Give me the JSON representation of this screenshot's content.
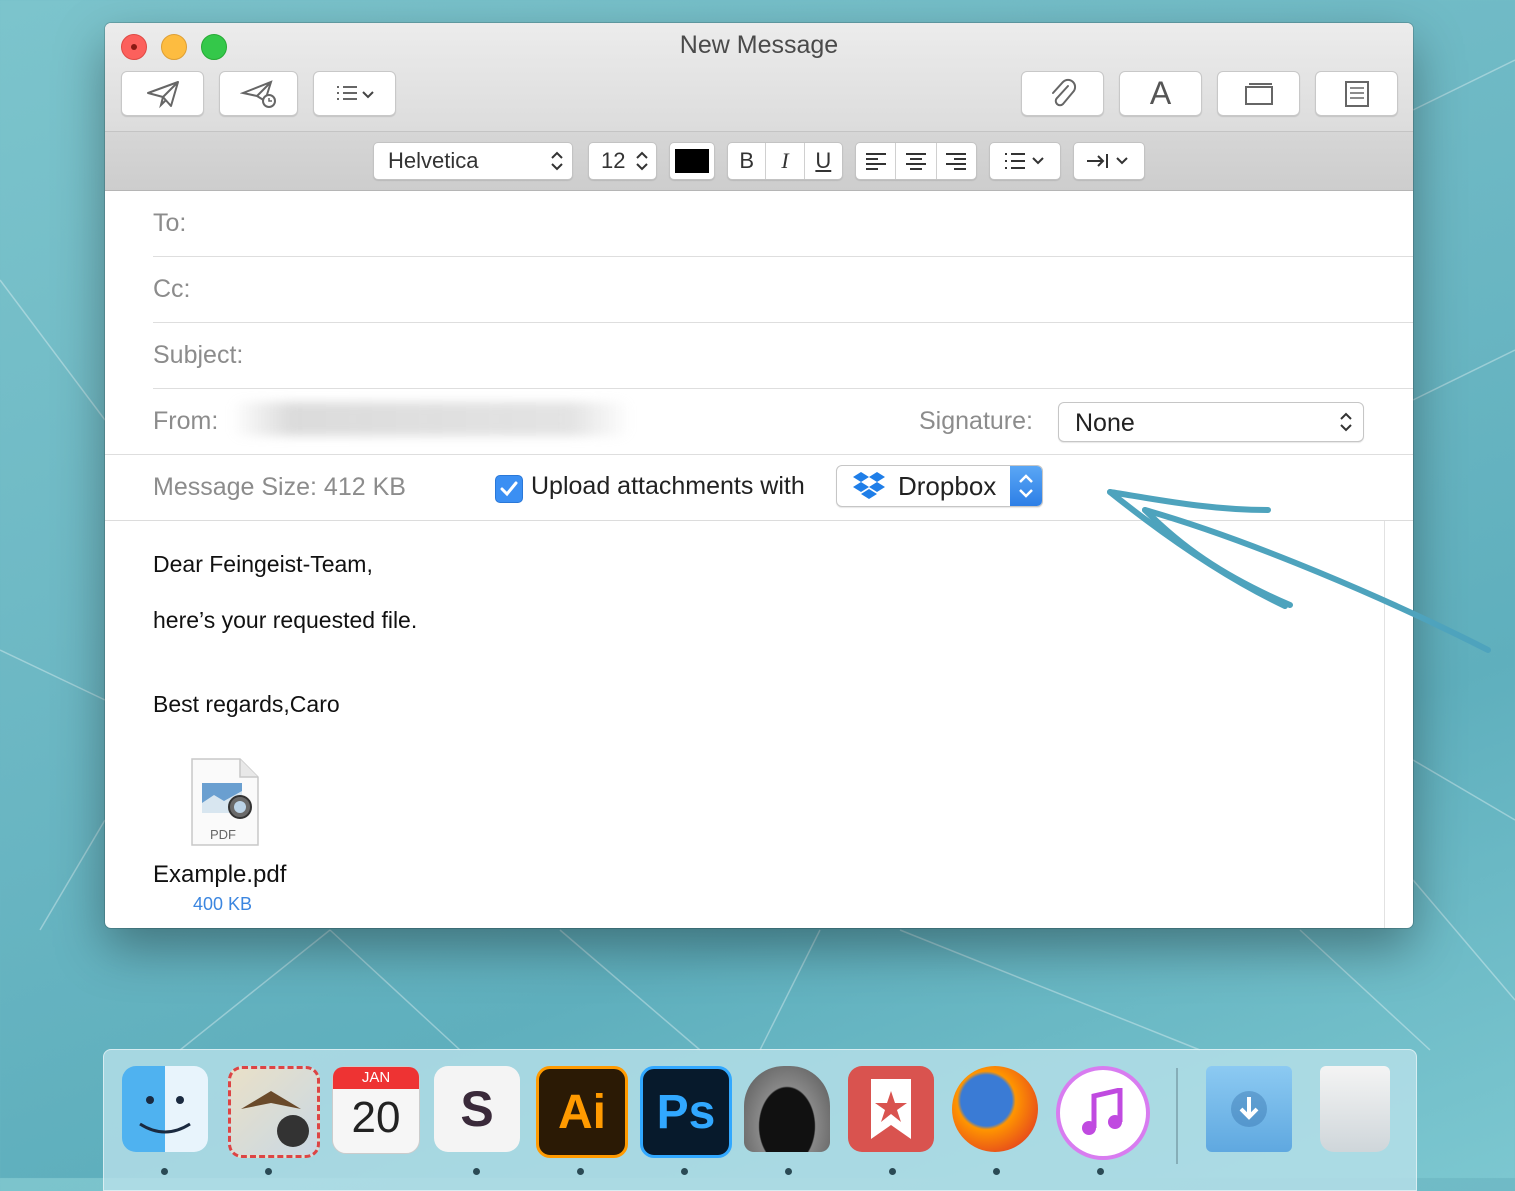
{
  "window": {
    "title": "New Message"
  },
  "toolbar": {
    "send_icon": "paper-plane-icon",
    "send_later_icon": "paper-plane-clock-icon",
    "list_icon": "list-icon",
    "attach_icon": "paperclip-icon",
    "fonts_label": "A",
    "photo_browser_icon": "window-icon",
    "stationery_icon": "stationery-icon"
  },
  "format": {
    "font": "Helvetica",
    "size": "12",
    "color": "#000000",
    "bold": "B",
    "italic": "I",
    "underline": "U"
  },
  "headers": {
    "to_label": "To:",
    "cc_label": "Cc:",
    "subject_label": "Subject:",
    "from_label": "From:",
    "signature_label": "Signature:",
    "signature_value": "None"
  },
  "attachments_bar": {
    "size_label": "Message Size: 412 KB",
    "upload_label": "Upload attachments with",
    "upload_checked": true,
    "service": "Dropbox"
  },
  "body": {
    "line1": "Dear Feingeist-Team,",
    "line2": "here’s your requested file.",
    "line3": "Best regards,Caro"
  },
  "attachment": {
    "file_type": "PDF",
    "name": "Example.pdf",
    "size": "400 KB"
  },
  "dock": {
    "calendar_month": "JAN",
    "calendar_day": "20",
    "illustrator": "Ai",
    "photoshop": "Ps",
    "slack_letter": "S"
  }
}
